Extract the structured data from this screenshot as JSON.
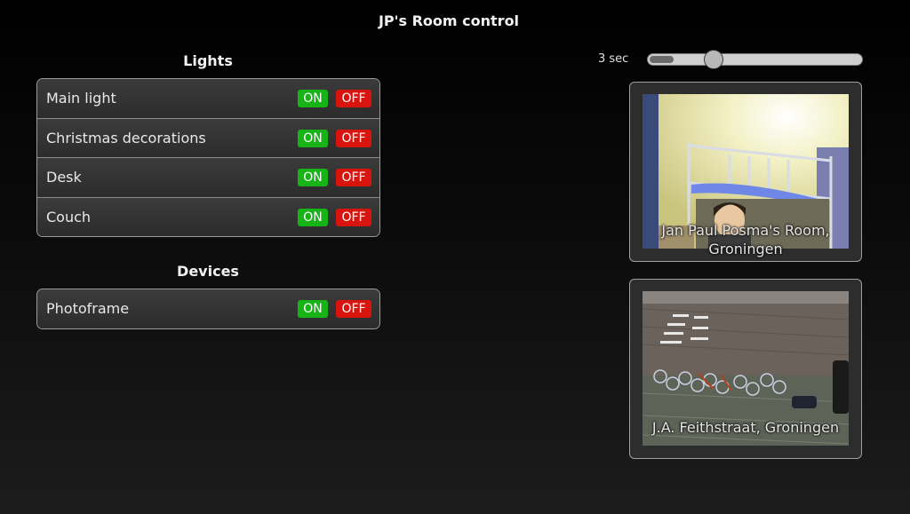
{
  "app": {
    "title": "JP's Room control"
  },
  "lights": {
    "heading": "Lights",
    "items": [
      {
        "label": "Main light",
        "on_label": "ON",
        "off_label": "OFF"
      },
      {
        "label": "Christmas decorations",
        "on_label": "ON",
        "off_label": "OFF"
      },
      {
        "label": "Desk",
        "on_label": "ON",
        "off_label": "OFF"
      },
      {
        "label": "Couch",
        "on_label": "ON",
        "off_label": "OFF"
      }
    ]
  },
  "devices": {
    "heading": "Devices",
    "items": [
      {
        "label": "Photoframe",
        "on_label": "ON",
        "off_label": "OFF"
      }
    ]
  },
  "refresh": {
    "label": "3 sec",
    "level": 0.31
  },
  "cameras": [
    {
      "caption": "Jan Paul Posma's Room, Groningen"
    },
    {
      "caption": "J.A. Feithstraat, Groningen"
    }
  ],
  "colors": {
    "on_button": "#17b317",
    "off_button": "#d8140f",
    "panel_border": "#9a9a9a"
  }
}
